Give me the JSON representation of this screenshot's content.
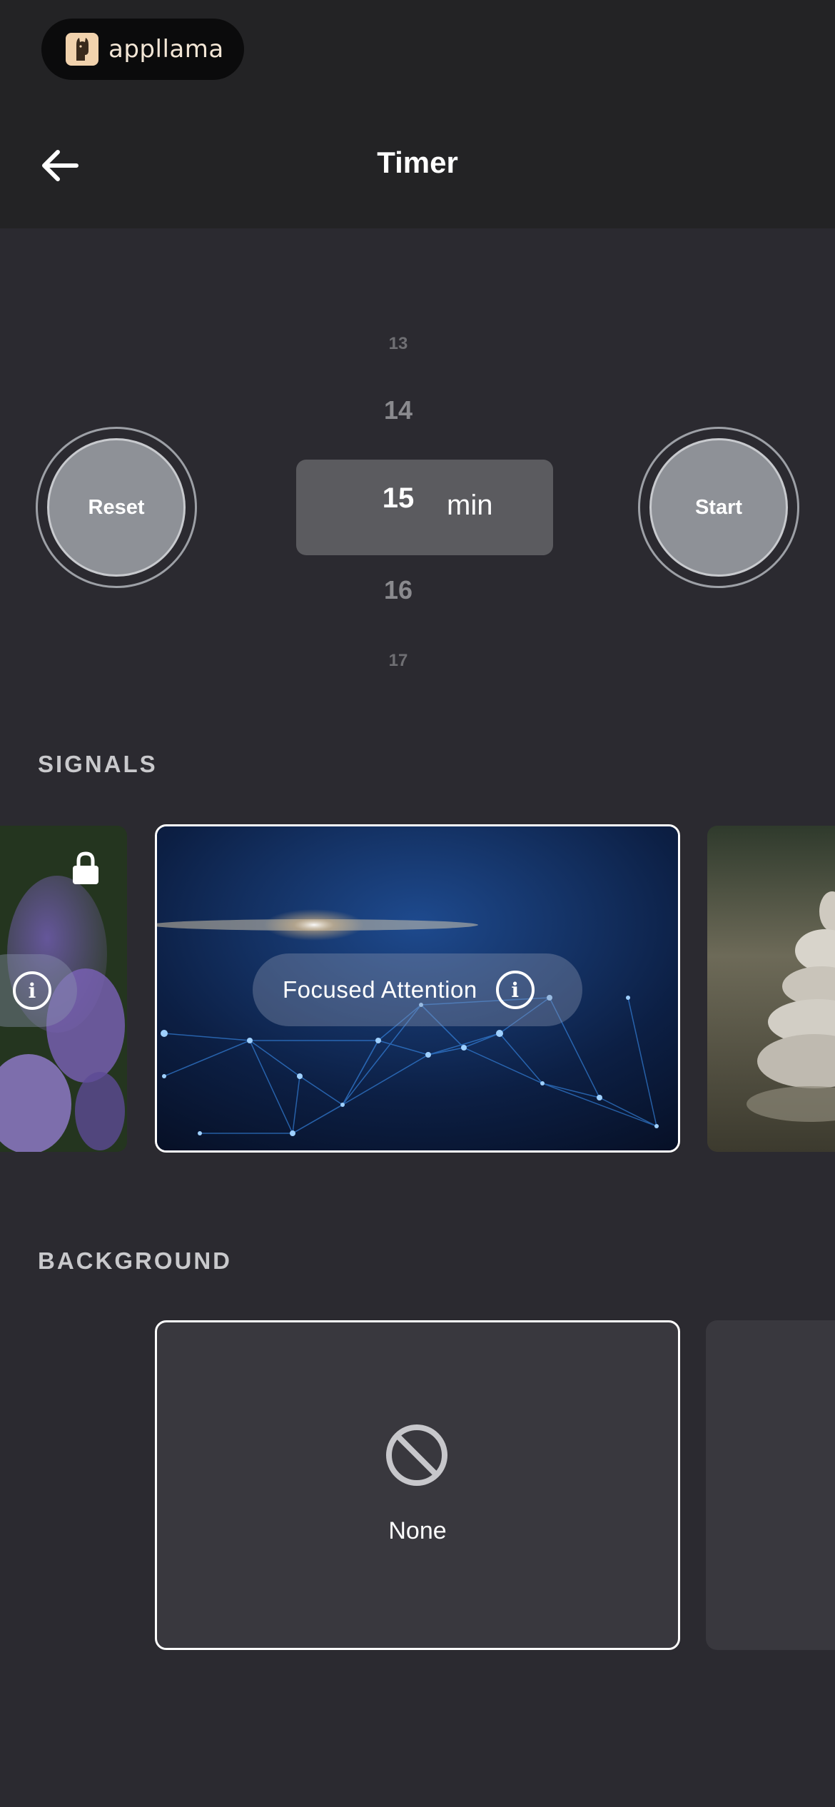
{
  "brand": {
    "name": "appllama"
  },
  "header": {
    "title": "Timer"
  },
  "timer": {
    "reset_label": "Reset",
    "start_label": "Start",
    "picker_values": [
      "13",
      "14",
      "15",
      "16",
      "17"
    ],
    "selected_value": "15",
    "unit": "min"
  },
  "signals": {
    "section_label": "SIGNALS",
    "selected": {
      "label": "Focused Attention"
    }
  },
  "background": {
    "section_label": "BACKGROUND",
    "selected": {
      "label": "None"
    }
  },
  "icons": {
    "back": "arrow-left-icon",
    "lock": "lock-icon",
    "info": "info-icon",
    "none": "prohibited-icon"
  }
}
